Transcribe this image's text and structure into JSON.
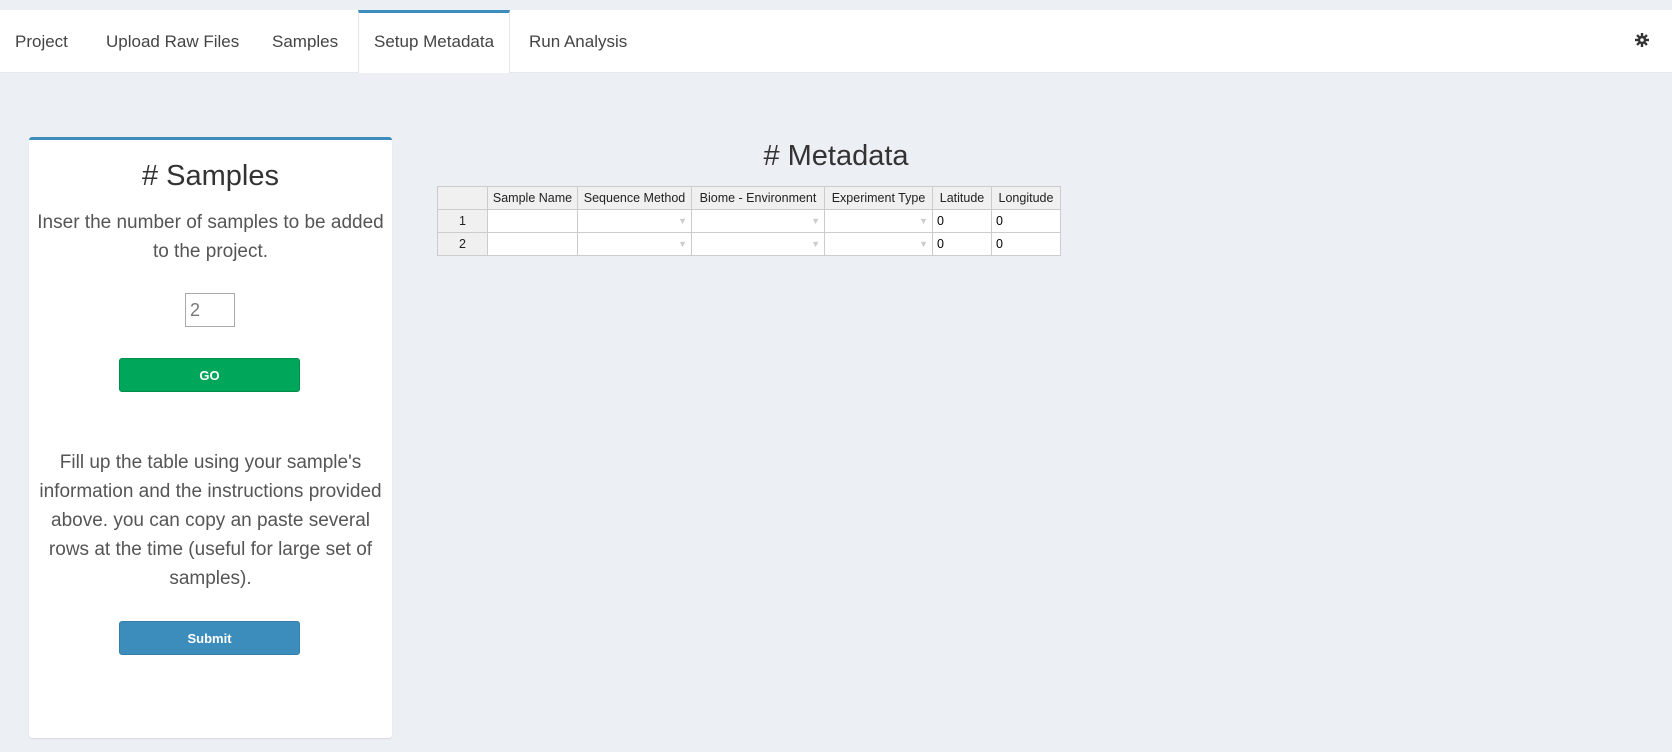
{
  "nav": {
    "tabs": [
      "Project",
      "Upload Raw Files",
      "Samples",
      "Setup Metadata",
      "Run Analysis"
    ],
    "active_tab": "Setup Metadata",
    "settings_icon": "gear-icon"
  },
  "samples_panel": {
    "title": "# Samples",
    "description": "Inser the number of samples to be added to the project.",
    "sample_count_value": "2",
    "go_label": "GO",
    "help_text": "Fill up the table using your sample's information and the instructions provided above. you can copy an paste several rows at the time (useful for large set of samples).",
    "submit_label": "Submit"
  },
  "metadata": {
    "title": "# Metadata",
    "columns": [
      "",
      "Sample Name",
      "Sequence Method",
      "Biome - Environment",
      "Experiment Type",
      "Latitude",
      "Longitude"
    ],
    "rows": [
      {
        "index": "1",
        "sample_name": "",
        "sequence_method": "",
        "biome": "",
        "experiment_type": "",
        "latitude": "0",
        "longitude": "0"
      },
      {
        "index": "2",
        "sample_name": "",
        "sequence_method": "",
        "biome": "",
        "experiment_type": "",
        "latitude": "0",
        "longitude": "0"
      }
    ],
    "dropdown_icon": "▼"
  },
  "colors": {
    "accent": "#3c8dbc",
    "go_button": "#00a65a",
    "background": "#ecf0f5"
  }
}
